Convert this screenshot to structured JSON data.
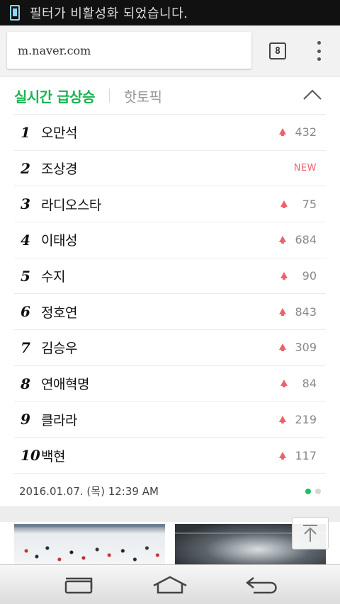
{
  "status_bar": {
    "notification_text": "필터가 비활성화 되었습니다."
  },
  "browser": {
    "url": "m.naver.com",
    "tab_count": "8"
  },
  "ranking": {
    "tab_active": "실시간 급상승",
    "tab_inactive": "핫토픽",
    "items": [
      {
        "rank": "1",
        "name": "오만석",
        "change": "432",
        "trend": "up"
      },
      {
        "rank": "2",
        "name": "조상경",
        "change": "NEW",
        "trend": "new"
      },
      {
        "rank": "3",
        "name": "라디오스타",
        "change": "75",
        "trend": "up"
      },
      {
        "rank": "4",
        "name": "이태성",
        "change": "684",
        "trend": "up"
      },
      {
        "rank": "5",
        "name": "수지",
        "change": "90",
        "trend": "up"
      },
      {
        "rank": "6",
        "name": "정호연",
        "change": "843",
        "trend": "up"
      },
      {
        "rank": "7",
        "name": "김승우",
        "change": "309",
        "trend": "up"
      },
      {
        "rank": "8",
        "name": "연애혁명",
        "change": "84",
        "trend": "up"
      },
      {
        "rank": "9",
        "name": "클라라",
        "change": "219",
        "trend": "up"
      },
      {
        "rank": "10",
        "name": "백현",
        "change": "117",
        "trend": "up"
      }
    ],
    "timestamp": "2016.01.07. (목) 12:39 AM",
    "pagination": {
      "total": 2,
      "active": 1
    }
  },
  "colors": {
    "accent_green": "#19b350",
    "trend_red": "#f0616d"
  },
  "icons": {
    "status": "phone-icon",
    "tabs": "tab-count-icon",
    "menu": "more-vert-icon",
    "collapse": "chevron-up-icon",
    "scroll_top": "scroll-to-top-icon",
    "nav_recent": "recent-apps-icon",
    "nav_home": "home-icon",
    "nav_back": "back-icon"
  }
}
